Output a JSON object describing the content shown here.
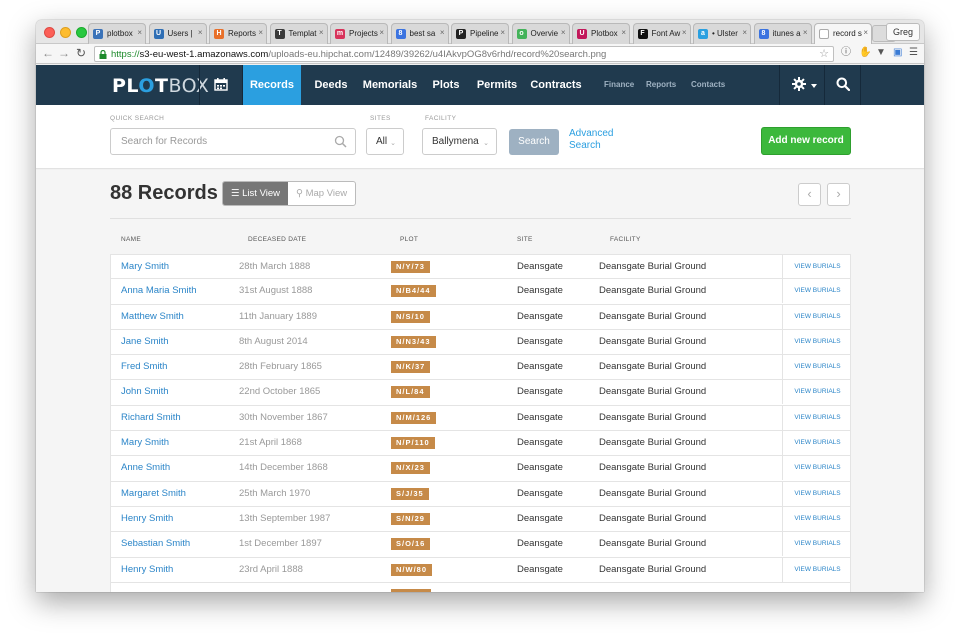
{
  "browser": {
    "tabs": [
      {
        "label": "plotbox",
        "fav_color": "#3b73b9",
        "fav": "P"
      },
      {
        "label": "Users |",
        "fav_color": "#2f6fb5",
        "fav": "U"
      },
      {
        "label": "Reports",
        "fav_color": "#e8702a",
        "fav": "H"
      },
      {
        "label": "Templat",
        "fav_color": "#3a3a3a",
        "fav": "T"
      },
      {
        "label": "Projects",
        "fav_color": "#d8335b",
        "fav": "m"
      },
      {
        "label": "best sa",
        "fav_color": "#3b73e0",
        "fav": "8"
      },
      {
        "label": "Pipeline",
        "fav_color": "#222222",
        "fav": "P"
      },
      {
        "label": "Overvie",
        "fav_color": "#44b35a",
        "fav": "o"
      },
      {
        "label": "Plotbox",
        "fav_color": "#c2185b",
        "fav": "U"
      },
      {
        "label": "Font Aw",
        "fav_color": "#111111",
        "fav": "F"
      },
      {
        "label": "• Ulster",
        "fav_color": "#2aa0e0",
        "fav": "a"
      },
      {
        "label": "itunes a",
        "fav_color": "#3b73e0",
        "fav": "8"
      },
      {
        "label": "record s",
        "fav_color": "#ffffff",
        "fav": ""
      }
    ],
    "user": "Greg",
    "url": {
      "scheme": "https://",
      "host": "s3-eu-west-1.amazonaws.com",
      "path": "/uploads-eu.hipchat.com/12489/39262/u4IAkvpOG8v6rhd/record%20search.png"
    }
  },
  "nav": {
    "logo": {
      "bold": "PL",
      "mid": "O",
      "end": "T",
      "light": "BOX"
    },
    "items": [
      "Records",
      "Deeds",
      "Memorials",
      "Plots",
      "Permits",
      "Contracts"
    ],
    "sub_items": [
      "Finance",
      "Reports",
      "Contacts"
    ],
    "accent": "#2b9fe0"
  },
  "search": {
    "quick_label": "QUICK SEARCH",
    "placeholder": "Search for Records",
    "sites_label": "SITES",
    "sites_value": "All",
    "facility_label": "FACILITY",
    "facility_value": "Ballymena",
    "search_button": "Search",
    "advanced_line1": "Advanced",
    "advanced_line2": "Search",
    "add_button": "Add new record"
  },
  "main": {
    "title": "88 Records",
    "list_view": "List View",
    "map_view": "Map View",
    "columns": [
      "NAME",
      "DECEASED DATE",
      "PLOT",
      "SITE",
      "FACILITY"
    ],
    "view_label": "VIEW BURIALS",
    "rows": [
      {
        "name": "Mary Smith",
        "date": "28th March 1888",
        "plot": "N/Y/73",
        "site": "Deansgate",
        "facility": "Deansgate Burial Ground"
      },
      {
        "name": "Anna Maria Smith",
        "date": "31st August 1888",
        "plot": "N/B4/44",
        "site": "Deansgate",
        "facility": "Deansgate Burial Ground"
      },
      {
        "name": "Matthew Smith",
        "date": "11th January 1889",
        "plot": "N/S/10",
        "site": "Deansgate",
        "facility": "Deansgate Burial Ground"
      },
      {
        "name": "Jane Smith",
        "date": "8th August 2014",
        "plot": "N/N3/43",
        "site": "Deansgate",
        "facility": "Deansgate Burial Ground"
      },
      {
        "name": "Fred Smith",
        "date": "28th February 1865",
        "plot": "N/K/37",
        "site": "Deansgate",
        "facility": "Deansgate Burial Ground"
      },
      {
        "name": "John Smith",
        "date": "22nd October 1865",
        "plot": "N/L/84",
        "site": "Deansgate",
        "facility": "Deansgate Burial Ground"
      },
      {
        "name": "Richard Smith",
        "date": "30th November 1867",
        "plot": "N/M/126",
        "site": "Deansgate",
        "facility": "Deansgate Burial Ground"
      },
      {
        "name": "Mary Smith",
        "date": "21st April 1868",
        "plot": "N/P/110",
        "site": "Deansgate",
        "facility": "Deansgate Burial Ground"
      },
      {
        "name": "Anne Smith",
        "date": "14th December 1868",
        "plot": "N/X/23",
        "site": "Deansgate",
        "facility": "Deansgate Burial Ground"
      },
      {
        "name": "Margaret Smith",
        "date": "25th March 1970",
        "plot": "S/J/35",
        "site": "Deansgate",
        "facility": "Deansgate Burial Ground"
      },
      {
        "name": "Henry Smith",
        "date": "13th September 1987",
        "plot": "S/N/29",
        "site": "Deansgate",
        "facility": "Deansgate Burial Ground"
      },
      {
        "name": "Sebastian Smith",
        "date": "1st December 1897",
        "plot": "S/O/16",
        "site": "Deansgate",
        "facility": "Deansgate Burial Ground"
      },
      {
        "name": "Henry Smith",
        "date": "23rd April 1888",
        "plot": "N/W/80",
        "site": "Deansgate",
        "facility": "Deansgate Burial Ground"
      },
      {
        "name": "",
        "date": "",
        "plot": "",
        "site": "",
        "facility": ""
      }
    ]
  }
}
